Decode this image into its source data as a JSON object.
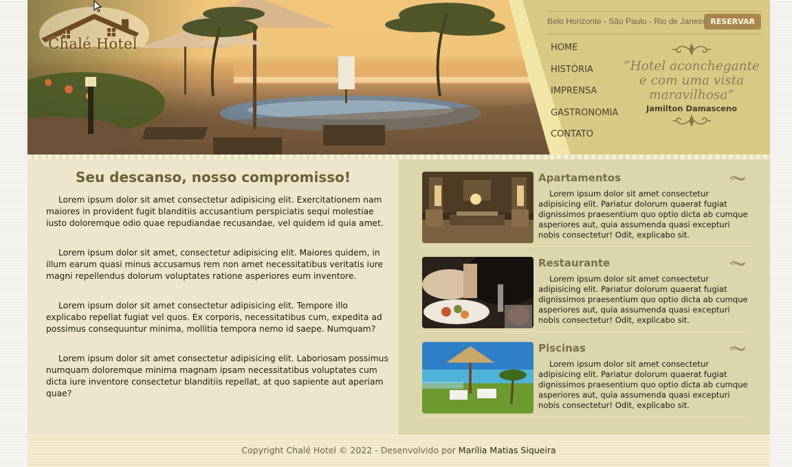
{
  "brand": {
    "logo_text": "Chalé Hotel"
  },
  "topbar": {
    "cities": "Belo Horizonte - São Paulo - Rio de Janeiro",
    "reserve_label": "RESERVAR"
  },
  "nav": {
    "items": [
      "HOME",
      "HISTÓRIA",
      "IMPRENSA",
      "GASTRONOMIA",
      "CONTATO"
    ]
  },
  "quote": {
    "text": "“Hotel aconchegante e com uma vista maravilhosa”",
    "author": "Jamilton Damasceno"
  },
  "main": {
    "headline": "Seu descanso, nosso compromisso!",
    "paragraphs": [
      "Lorem ipsum dolor sit amet consectetur adipisicing elit. Exercitationem nam maiores in provident fugit blanditiis accusantium perspiciatis sequi molestiae iusto doloremque odio quae repudiandae recusandae, vel quidem id quia amet.",
      "Lorem ipsum dolor sit amet, consectetur adipisicing elit. Maiores quidem, in illum earum quasi minus accusamus rem non amet necessitatibus veritatis iure magni repellendus dolorum voluptates ratione asperiores eum inventore.",
      "Lorem ipsum dolor sit amet consectetur adipisicing elit. Tempore illo explicabo repellat fugiat vel quos. Ex corporis, necessitatibus cum, expedita ad possimus consequuntur minima, mollitia tempora nemo id saepe. Numquam?",
      "Lorem ipsum dolor sit amet consectetur adipisicing elit. Laboriosam possimus numquam doloremque minima magnam ipsam necessitatibus voluptates cum dicta iure inventore consectetur blanditiis repellat, at quo sapiente aut aperiam quae?"
    ]
  },
  "cards": [
    {
      "title": "Apartamentos",
      "icon": "apartment-photo",
      "text": "Lorem ipsum dolor sit amet consectetur adipisicing elit. Pariatur dolorum quaerat fugiat dignissimos praesentium quo optio dicta ab cumque asperiores aut, quia assumenda quasi excepturi nobis consectetur! Odit, explicabo sit."
    },
    {
      "title": "Restaurante",
      "icon": "restaurant-photo",
      "text": "Lorem ipsum dolor sit amet consectetur adipisicing elit. Pariatur dolorum quaerat fugiat dignissimos praesentium quo optio dicta ab cumque asperiores aut, quia assumenda quasi excepturi nobis consectetur! Odit, explicabo sit."
    },
    {
      "title": "Piscinas",
      "icon": "pool-photo",
      "text": "Lorem ipsum dolor sit amet consectetur adipisicing elit. Pariatur dolorum quaerat fugiat dignissimos praesentium quo optio dicta ab cumque asperiores aut, quia assumenda quasi excepturi nobis consectetur! Odit, explicabo sit."
    }
  ],
  "footer": {
    "text": "Copyright Chalé Hotel © 2022 - Desenvolvido por",
    "author_link": "Marília Matias Siqueira"
  },
  "colors": {
    "accent": "#a8874f",
    "header_bg": "#d8c985",
    "left_bg": "#ede6cc",
    "right_bg": "#dcd6ad",
    "heading": "#6b5f3a"
  }
}
